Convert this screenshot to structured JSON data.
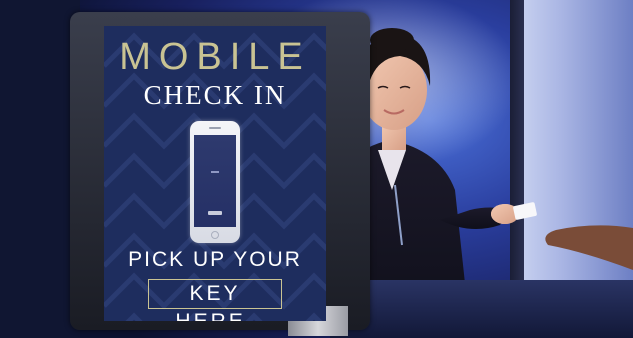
{
  "sign": {
    "line1": "MOBILE",
    "line2": "CHECK IN",
    "line3": "PICK UP YOUR",
    "line4": "KEY HERE."
  },
  "colors": {
    "sign_background": "#1e2d5e",
    "sign_gold_text": "#c9c393",
    "sign_white_text": "#ffffff",
    "ambient_blue": "#2a3e9e"
  }
}
